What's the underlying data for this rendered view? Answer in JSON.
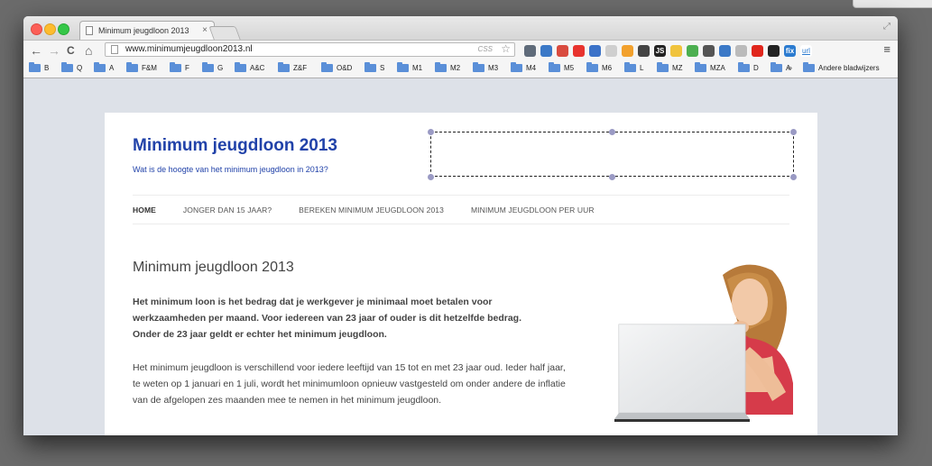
{
  "browser": {
    "tab_title": "Minimum jeugdloon 2013",
    "tab_close": "×",
    "url": "www.minimumjeugdloon2013.nl",
    "css_tag": "CSS",
    "nav": {
      "back": "←",
      "forward": "→",
      "reload": "C",
      "home": "⌂"
    },
    "extensions": [
      {
        "label": "",
        "color": "#5f6b7a",
        "icon": "camera-icon"
      },
      {
        "label": "",
        "color": "#3b79c7",
        "icon": "download-icon"
      },
      {
        "label": "",
        "color": "#d94b3f",
        "icon": "pin-icon"
      },
      {
        "label": "",
        "color": "#e8332e",
        "icon": "opera-icon"
      },
      {
        "label": "",
        "color": "#3b72c8",
        "icon": "screen-icon"
      },
      {
        "label": "",
        "color": "#cfcfcf",
        "icon": "note-icon"
      },
      {
        "label": "",
        "color": "#f2a12d",
        "icon": "sun-icon"
      },
      {
        "label": "",
        "color": "#444444",
        "icon": "gear-icon"
      },
      {
        "label": "JS",
        "color": "#222222",
        "icon": "js-icon"
      },
      {
        "label": "",
        "color": "#f0c33c",
        "icon": "sticky-icon"
      },
      {
        "label": "",
        "color": "#4caf50",
        "icon": "chart-icon"
      },
      {
        "label": "",
        "color": "#555555",
        "icon": "pocket-icon"
      },
      {
        "label": "",
        "color": "#3b79c7",
        "icon": "translate-icon"
      },
      {
        "label": "",
        "color": "#bbbbbb",
        "icon": "circle-icon"
      },
      {
        "label": "",
        "color": "#e0261c",
        "icon": "youtube-icon"
      },
      {
        "label": "",
        "color": "#222222",
        "icon": "dark-icon"
      },
      {
        "label": "fix",
        "color": "#2b7bd0",
        "icon": "fix-icon"
      },
      {
        "label": "url",
        "color": "#ffffff",
        "icon": "url-icon"
      }
    ],
    "menu_icon": "≡",
    "bookmarks": [
      "B",
      "Q",
      "A",
      "F&M",
      "F",
      "G",
      "A&C",
      "Z&F",
      "O&D",
      "S",
      "M1",
      "M2",
      "M3",
      "M4",
      "M5",
      "M6",
      "L",
      "MZ",
      "MZA",
      "D",
      "A"
    ],
    "bookmarks_more": "»",
    "bookmarks_other": "Andere bladwijzers"
  },
  "site": {
    "title": "Minimum jeugdloon 2013",
    "description": "Wat is de hoogte van het minimum jeugdloon in 2013?",
    "nav": [
      "HOME",
      "JONGER DAN 15 JAAR?",
      "BEREKEN MINIMUM JEUGDLOON 2013",
      "MINIMUM JEUGDLOON PER UUR"
    ]
  },
  "article": {
    "title": "Minimum jeugdloon 2013",
    "lead": "Het minimum loon is het bedrag dat je werkgever je minimaal moet betalen voor werkzaamheden per maand. Voor iedereen van 23 jaar of ouder is dit hetzelfde bedrag. Onder de 23 jaar geldt er echter het minimum jeugdloon.",
    "body": "Het minimum jeugdloon is verschillend voor iedere leeftijd van 15 tot en met 23 jaar oud. Ieder half jaar, te weten op 1 januari en 1 juli, wordt het minimumloon opnieuw vastgesteld om onder andere de inflatie van de afgelopen zes maanden mee te nemen in het minimum jeugdloon."
  },
  "colors": {
    "brand": "#2142a9",
    "page_bg": "#dde1e8"
  }
}
